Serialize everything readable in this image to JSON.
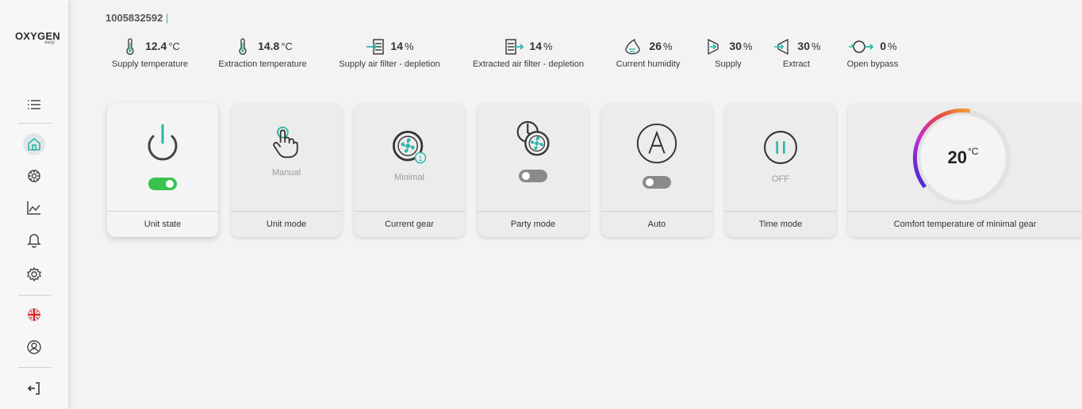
{
  "app": {
    "logo_text": "OXYGEN",
    "logo_sub": "easy"
  },
  "serial": "1005832592",
  "colors": {
    "accent": "#2ab7a8",
    "toggle_on": "#38c24e",
    "toggle_off": "#8a8a8a",
    "dial_gradient": [
      "#2b2bd6",
      "#c42bd0",
      "#e64b3c",
      "#f0a53c"
    ]
  },
  "sidebar": {
    "items": [
      {
        "name": "menu-icon"
      },
      {
        "name": "home-icon",
        "active": true
      },
      {
        "name": "fan-settings-icon"
      },
      {
        "name": "chart-icon"
      },
      {
        "name": "bell-icon"
      },
      {
        "name": "gear-icon"
      },
      {
        "name": "uk-flag-icon"
      },
      {
        "name": "user-icon"
      },
      {
        "name": "logout-icon"
      }
    ]
  },
  "stats": [
    {
      "id": "supply-temp",
      "icon": "thermometer-icon",
      "value": "12.4",
      "unit": "°C",
      "label": "Supply temperature"
    },
    {
      "id": "extraction-temp",
      "icon": "thermometer-icon",
      "value": "14.8",
      "unit": "°C",
      "label": "Extraction temperature"
    },
    {
      "id": "supply-filter",
      "icon": "filter-in-icon",
      "value": "14",
      "unit": "%",
      "label": "Supply air filter - depletion"
    },
    {
      "id": "extract-filter",
      "icon": "filter-out-icon",
      "value": "14",
      "unit": "%",
      "label": "Extracted air filter - depletion"
    },
    {
      "id": "humidity",
      "icon": "humidity-icon",
      "value": "26",
      "unit": "%",
      "label": "Current humidity"
    },
    {
      "id": "supply",
      "icon": "supply-icon",
      "value": "30",
      "unit": "%",
      "label": "Supply"
    },
    {
      "id": "extract",
      "icon": "extract-icon",
      "value": "30",
      "unit": "%",
      "label": "Extract"
    },
    {
      "id": "bypass",
      "icon": "bypass-icon",
      "value": "0",
      "unit": "%",
      "label": "Open bypass"
    }
  ],
  "cards": [
    {
      "id": "unit-state",
      "icon": "power-icon",
      "label": "Unit state",
      "toggle": "on"
    },
    {
      "id": "unit-mode",
      "icon": "hand-pointer-icon",
      "label": "Unit mode",
      "sub": "Manual"
    },
    {
      "id": "current-gear",
      "icon": "fan-gear-icon",
      "label": "Current gear",
      "sub": "Minimal"
    },
    {
      "id": "party-mode",
      "icon": "party-fan-icon",
      "label": "Party mode",
      "toggle": "off"
    },
    {
      "id": "auto",
      "icon": "auto-icon",
      "label": "Auto",
      "toggle": "off"
    },
    {
      "id": "time-mode",
      "icon": "pause-icon",
      "label": "Time mode",
      "sub": "OFF"
    }
  ],
  "comfort": {
    "value": "20",
    "unit": "°C",
    "label": "Comfort temperature of minimal gear"
  }
}
